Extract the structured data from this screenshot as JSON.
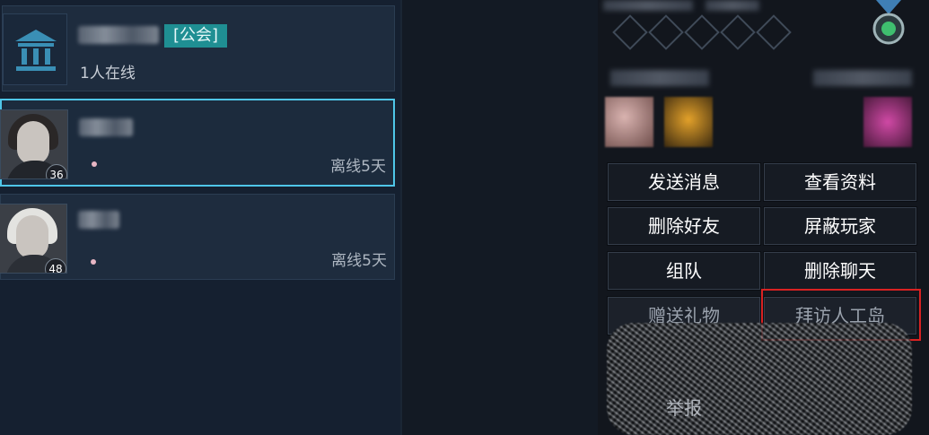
{
  "guild": {
    "tag": "[公会]",
    "online": "1人在线",
    "icon": "bank-building-icon"
  },
  "friends": [
    {
      "level": "36",
      "status": "离线5天"
    },
    {
      "level": "48",
      "status": "离线5天"
    }
  ],
  "actions": {
    "send_message": "发送消息",
    "view_profile": "查看资料",
    "delete_friend": "删除好友",
    "block_player": "屏蔽玩家",
    "team_up": "组队",
    "delete_chat": "删除聊天",
    "send_gift": "赠送礼物",
    "visit_island": "拜访人工岛",
    "report": "举报"
  },
  "colors": {
    "selected_border": "#4fc6e8",
    "guild_tag_bg": "#1f8f93",
    "highlight": "#d92222"
  }
}
